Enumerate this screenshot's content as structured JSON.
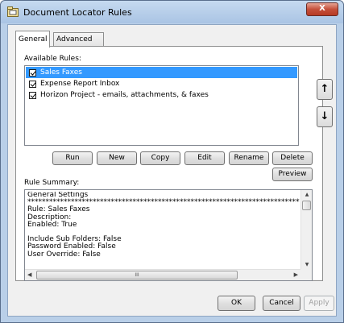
{
  "window": {
    "title": "Document Locator Rules",
    "close_label": "X"
  },
  "tabs": [
    {
      "label": "General",
      "active": true
    },
    {
      "label": "Advanced",
      "active": false
    }
  ],
  "rules": {
    "label": "Available Rules:",
    "items": [
      {
        "label": "Sales Faxes",
        "checked": true,
        "selected": true
      },
      {
        "label": "Expense Report Inbox",
        "checked": true,
        "selected": false
      },
      {
        "label": "Horizon Project - emails, attachments, & faxes",
        "checked": true,
        "selected": false
      }
    ],
    "move_up_label": "↑",
    "move_down_label": "↓"
  },
  "actions": {
    "run": "Run",
    "new": "New",
    "copy": "Copy",
    "edit": "Edit",
    "rename": "Rename",
    "delete": "Delete",
    "preview": "Preview"
  },
  "summary": {
    "label": "Rule Summary:",
    "text": "General Settings\n*******************************************************************************\nRule: Sales Faxes\nDescription:\nEnabled: True\n\nInclude Sub Folders: False\nPassword Enabled: False\nUser Override: False\n",
    "hscroll_grip": "III"
  },
  "footer": {
    "ok": "OK",
    "cancel": "Cancel",
    "apply": "Apply"
  }
}
